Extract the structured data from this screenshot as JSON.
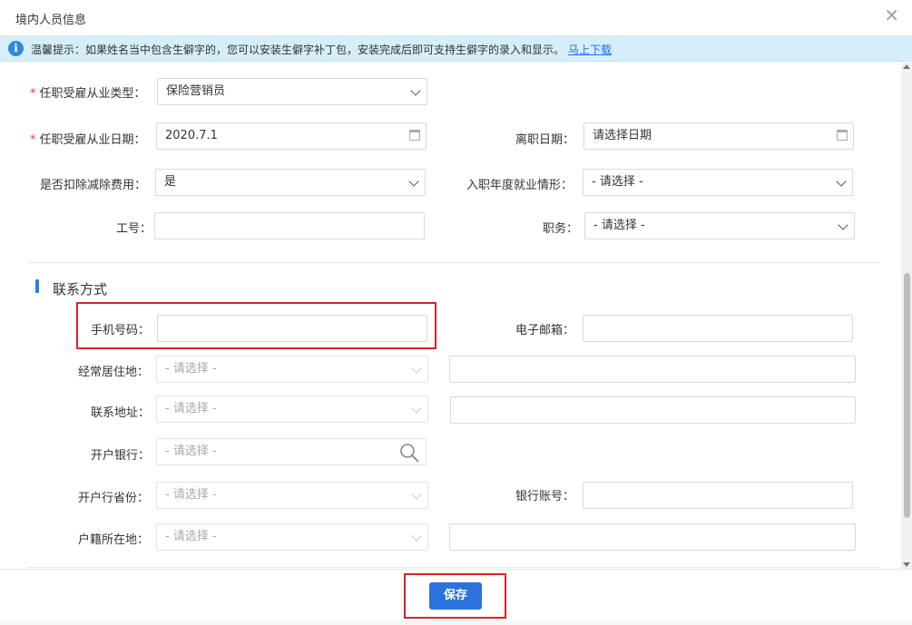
{
  "dialog": {
    "title": "境内人员信息",
    "close_symbol": "×"
  },
  "notice": {
    "icon": "info-icon",
    "icon_text": "i",
    "message": "温馨提示：如果姓名当中包含生僻字的，您可以安装生僻字补丁包，安装完成后即可支持生僻字的录入和显示。",
    "link_text": "马上下载"
  },
  "employment": {
    "type_label": "任职受雇从业类型：",
    "type_value": "保险营销员",
    "date_label": "任职受雇从业日期：",
    "date_value": "2020.7.1",
    "leave_date_label": "离职日期：",
    "leave_date_placeholder": "请选择日期",
    "deduct_label": "是否扣除减除费用：",
    "deduct_value": "是",
    "hire_status_label": "入职年度就业情形：",
    "hire_status_value": "- 请选择 -",
    "job_no_label": "工号",
    "position_label": "职务：",
    "position_value": "- 请选择 -"
  },
  "contact": {
    "section_title": "联系方式",
    "phone_label": "手机号码：",
    "phone_value": "",
    "email_label": "电子邮箱：",
    "email_value": "",
    "residence_label": "经常居住地：",
    "residence_value": "- 请选择 -",
    "address_label": "联系地址：",
    "address_value": "- 请选择 -",
    "bank_label": "开户银行：",
    "bank_value": "- 请选择 -",
    "bank_province_label": "开户行省份：",
    "bank_province_value": "- 请选择 -",
    "bank_account_label": "银行账号：",
    "bank_account_value": "",
    "hukou_label": "户籍所在地：",
    "hukou_value": "- 请选择 -"
  },
  "footer": {
    "save_label": "保存"
  },
  "colors": {
    "primary": "#2b73dc",
    "notice_bg": "#d6eefa",
    "highlight": "#d8232a",
    "required": "#e4393c"
  }
}
